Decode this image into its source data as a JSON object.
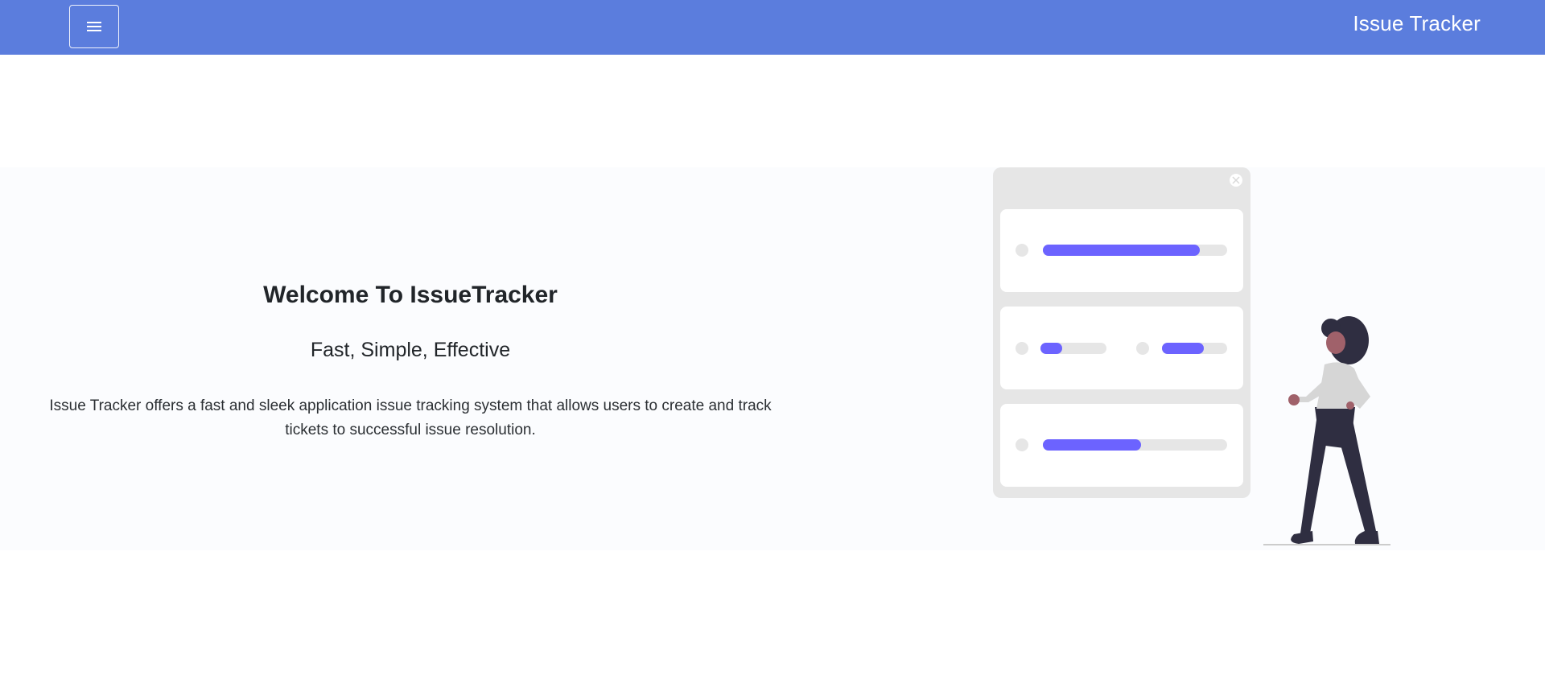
{
  "navbar": {
    "menu_icon": "hamburger-menu-icon",
    "brand": "Issue Tracker",
    "background": "#5b7ddd"
  },
  "hero": {
    "title": "Welcome To IssueTracker",
    "subtitle": "Fast, Simple, Effective",
    "description": "Issue Tracker offers a fast and sleek application issue tracking system that allows users to create and track tickets to successful issue resolution."
  },
  "illustration": {
    "accent": "#6c63ff",
    "progress_bars": [
      0.85,
      0.3,
      0.65,
      0.53
    ]
  }
}
